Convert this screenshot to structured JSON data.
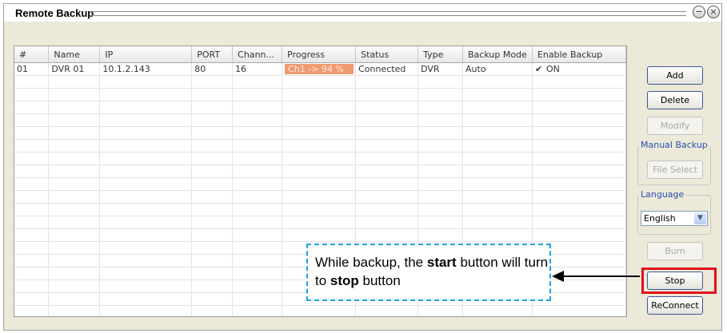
{
  "window": {
    "title": "Remote Backup"
  },
  "table": {
    "columns": [
      "#",
      "Name",
      "IP",
      "PORT",
      "Chann...",
      "Progress",
      "Status",
      "Type",
      "Backup Mode",
      "Enable Backup"
    ],
    "rows": [
      {
        "num": "01",
        "name": "DVR 01",
        "ip": "10.1.2.143",
        "port": "80",
        "channels": "16",
        "progress_text": "Ch1 -> 94 %",
        "progress_percent": 94,
        "status": "Connected",
        "type": "DVR",
        "backup_mode": "Auto",
        "enable_backup": "ON",
        "enable_checked": true
      }
    ]
  },
  "buttons": {
    "add": "Add",
    "delete": "Delete",
    "modify": "Modify",
    "file_select": "File Select",
    "burn": "Burn",
    "stop": "Stop",
    "reconnect": "ReConnect"
  },
  "groups": {
    "manual_backup": "Manual Backup",
    "language": "Language"
  },
  "language_select": {
    "value": "English"
  },
  "callout": {
    "text_1": "While backup, the ",
    "bold_1": "start",
    "text_2": " button will turn to ",
    "bold_2": "stop",
    "text_3": " button"
  },
  "colors": {
    "progress_fill": "#f09a72",
    "highlight": "#e0101a",
    "callout_border": "#1aa4e0"
  }
}
